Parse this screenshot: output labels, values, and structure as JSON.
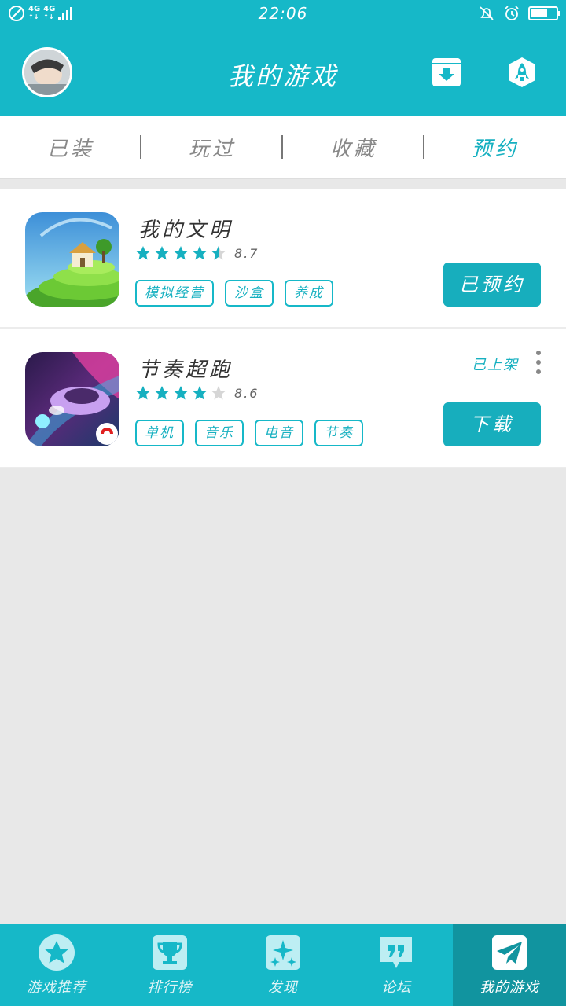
{
  "status_bar": {
    "network_1": "4G",
    "network_2": "4G",
    "time": "22:06"
  },
  "header": {
    "title": "我的游戏"
  },
  "tabs": [
    {
      "label": "已装"
    },
    {
      "label": "玩过"
    },
    {
      "label": "收藏"
    },
    {
      "label": "预约"
    }
  ],
  "active_tab": "预约",
  "games": [
    {
      "name": "我的文明",
      "rating": 8.7,
      "rating_text": "8.7",
      "tags": [
        "模拟经营",
        "沙盒",
        "养成"
      ],
      "action": "已预约"
    },
    {
      "name": "节奏超跑",
      "rating": 8.6,
      "rating_text": "8.6",
      "tags": [
        "单机",
        "音乐",
        "电音",
        "节奏"
      ],
      "status": "已上架",
      "action": "下载"
    }
  ],
  "bottom_nav": [
    {
      "label": "游戏推荐",
      "icon": "star-icon"
    },
    {
      "label": "排行榜",
      "icon": "trophy-icon"
    },
    {
      "label": "发现",
      "icon": "sparkle-icon"
    },
    {
      "label": "论坛",
      "icon": "quote-icon"
    },
    {
      "label": "我的游戏",
      "icon": "paper-plane-icon"
    }
  ],
  "colors": {
    "brand": "#16b8c8",
    "button": "#17aebd",
    "nav_active": "#11949f",
    "background": "#e8e8e8"
  }
}
